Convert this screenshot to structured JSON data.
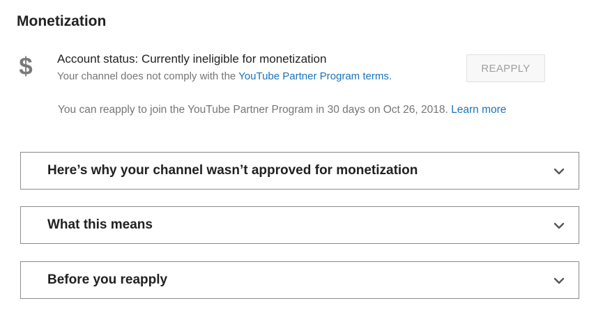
{
  "section": {
    "title": "Monetization"
  },
  "status": {
    "icon": "dollar-sign-icon",
    "icon_glyph": "$",
    "title": "Account status: Currently ineligible for monetization",
    "description_prefix": "Your channel does not comply with the ",
    "description_link": "YouTube Partner Program terms.",
    "reapply_button_label": "REAPPLY",
    "reapply_note": "You can reapply to join the YouTube Partner Program in 30 days on Oct 26, 2018.",
    "learn_more_label": "Learn more"
  },
  "accordions": [
    {
      "title": "Here’s why your channel wasn’t approved for monetization",
      "icon": "chevron-down-icon"
    },
    {
      "title": "What this means",
      "icon": "chevron-down-icon"
    },
    {
      "title": "Before you reapply",
      "icon": "chevron-down-icon"
    }
  ],
  "colors": {
    "link": "#1a73b8",
    "muted_text": "#757575",
    "border": "#8a8a8a",
    "disabled_button_text": "#9e9e9e"
  }
}
